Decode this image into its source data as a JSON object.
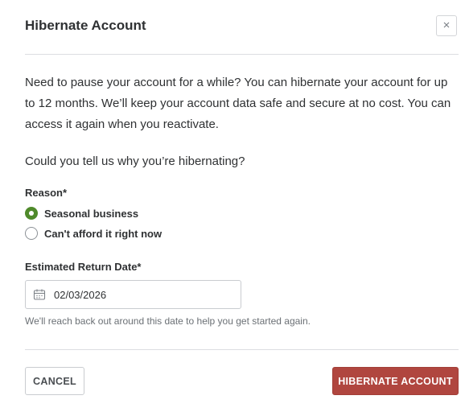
{
  "dialog": {
    "title": "Hibernate Account",
    "close_label": "×",
    "description": "Need to pause your account for a while? You can hibernate your account for up to 12 months. We’ll keep your account data safe and secure at no cost. You can access it again when you reactivate.",
    "question": "Could you tell us why you’re hibernating?"
  },
  "reason": {
    "label": "Reason*",
    "options": [
      {
        "label": "Seasonal business",
        "selected": true
      },
      {
        "label": "Can't afford it right now",
        "selected": false
      }
    ]
  },
  "return_date": {
    "label": "Estimated Return Date*",
    "value": "02/03/2026",
    "hint": "We'll reach back out around this date to help you get started again."
  },
  "footer": {
    "cancel_label": "CANCEL",
    "confirm_label": "HIBERNATE ACCOUNT"
  },
  "colors": {
    "accent_green": "#4f8a2b",
    "primary_button": "#b0463f"
  }
}
